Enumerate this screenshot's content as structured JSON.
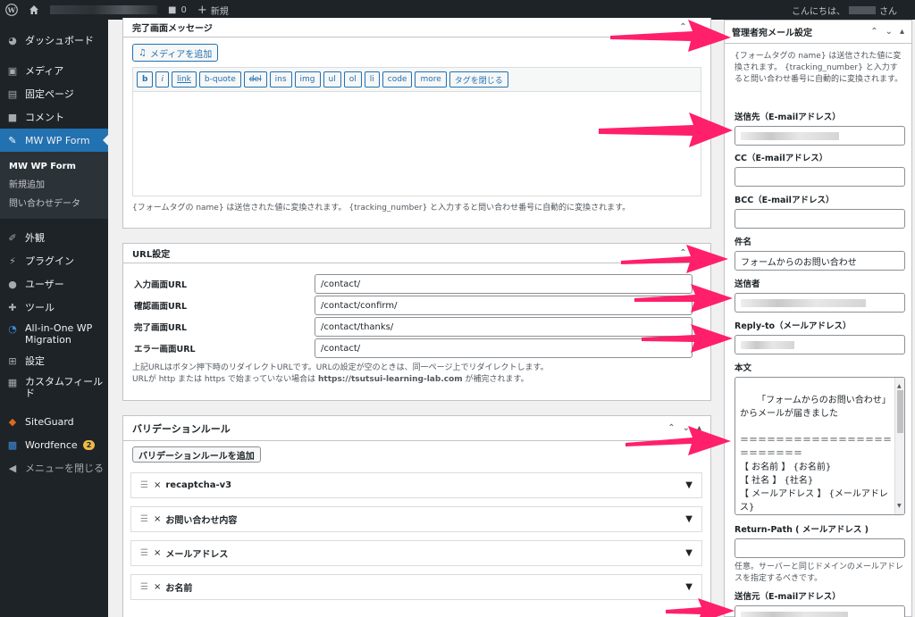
{
  "adminbar": {
    "comments_count": "0",
    "new_label": "新規",
    "greeting_prefix": "こんにちは、",
    "greeting_suffix": "さん"
  },
  "sidebar": {
    "items": [
      {
        "label": "ダッシュボード",
        "icon": "dashboard-icon"
      },
      {
        "label": "メディア",
        "icon": "media-icon"
      },
      {
        "label": "固定ページ",
        "icon": "page-icon"
      },
      {
        "label": "コメント",
        "icon": "comment-icon"
      },
      {
        "label": "MW WP Form",
        "icon": "pin-icon"
      }
    ],
    "submenu": [
      "MW WP Form",
      "新規追加",
      "問い合わせデータ"
    ],
    "items2": [
      {
        "label": "外観",
        "icon": "brush-icon"
      },
      {
        "label": "プラグイン",
        "icon": "plugin-icon"
      },
      {
        "label": "ユーザー",
        "icon": "user-icon"
      },
      {
        "label": "ツール",
        "icon": "wrench-icon"
      },
      {
        "label": "All-in-One WP Migration",
        "icon": "migration-icon"
      },
      {
        "label": "設定",
        "icon": "settings-icon"
      },
      {
        "label": "カスタムフィールド",
        "icon": "table-icon"
      }
    ],
    "items3": [
      {
        "label": "SiteGuard",
        "icon": "siteguard-icon"
      },
      {
        "label": "Wordfence",
        "icon": "wordfence-icon",
        "badge": "2"
      },
      {
        "label": "メニューを閉じる",
        "icon": "collapse-icon"
      }
    ]
  },
  "complete_message": {
    "title": "完了画面メッセージ",
    "add_media": "メディアを追加",
    "quicktags": [
      "b",
      "i",
      "link",
      "b-quote",
      "del",
      "ins",
      "img",
      "ul",
      "ol",
      "li",
      "code",
      "more",
      "タグを閉じる"
    ],
    "note": "{フォームタグの name} は送信された値に変換されます。 {tracking_number} と入力すると問い合わせ番号に自動的に変換されます。"
  },
  "url_settings": {
    "title": "URL設定",
    "rows": [
      {
        "label": "入力画面URL",
        "value": "/contact/"
      },
      {
        "label": "確認画面URL",
        "value": "/contact/confirm/"
      },
      {
        "label": "完了画面URL",
        "value": "/contact/thanks/"
      },
      {
        "label": "エラー画面URL",
        "value": "/contact/"
      }
    ],
    "note1": "上記URLはボタン押下時のリダイレクトURLです。URLの設定が空のときは、同一ページ上でリダイレクトします。",
    "note2_prefix": "URLが http または https で始まっていない場合は ",
    "note2_url": "https://tsutsui-learning-lab.com",
    "note2_suffix": " が補完されます。"
  },
  "validation": {
    "title": "バリデーションルール",
    "add_button": "バリデーションルールを追加",
    "rules": [
      "recaptcha-v3",
      "お問い合わせ内容",
      "メールアドレス",
      "お名前"
    ]
  },
  "admin_mail": {
    "title": "管理者宛メール設定",
    "intro": "{フォームタグの name} は送信された値に変換されます。 {tracking_number} と入力すると問い合わせ番号に自動的に変換されます。",
    "to_label": "送信先（E-mailアドレス）",
    "cc_label": "CC（E-mailアドレス）",
    "bcc_label": "BCC（E-mailアドレス）",
    "subject_label": "件名",
    "subject_value": "フォームからのお問い合わせ",
    "sender_label": "送信者",
    "replyto_label": "Reply-to（メールアドレス）",
    "body_label": "本文",
    "body_value": "「フォームからのお問い合わせ」からメールが届きました\n\n＝＝＝＝＝＝＝＝＝＝＝＝＝＝＝＝＝＝＝＝＝＝＝＝\n【 お名前 】 {お名前}\n【 社名 】 {社名}\n【 メールアドレス 】 {メールアドレス}\n【 電話番号 】 {電話番号}",
    "returnpath_label": "Return-Path ( メールアドレス )",
    "returnpath_note": "任意。サーバーと同じドメインのメールアドレスを指定するべきです。",
    "from_label": "送信元（E-mailアドレス）"
  },
  "colors": {
    "admin_dark": "#1d2327",
    "accent_blue": "#2271b1",
    "arrow_pink": "#ff1f6b"
  }
}
